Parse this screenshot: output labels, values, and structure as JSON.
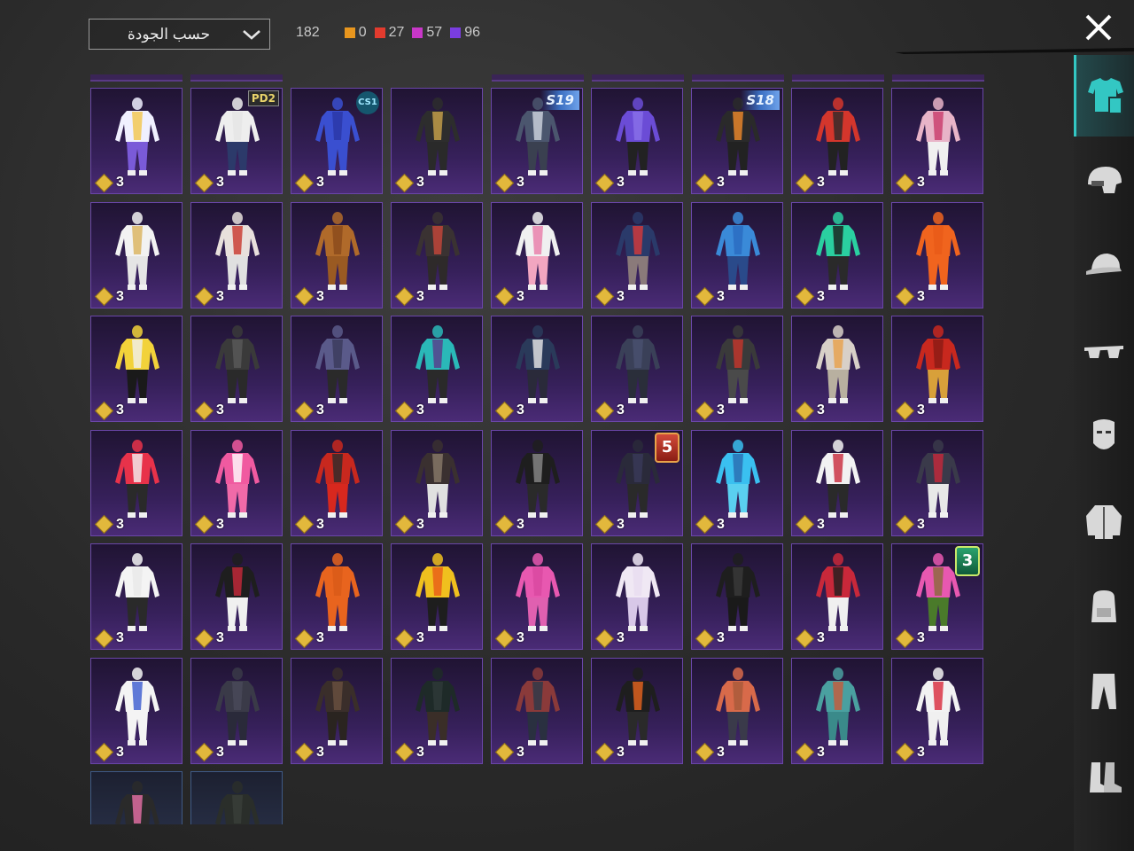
{
  "header": {
    "sort_label": "حسب الجودة",
    "total_count": "182",
    "quality_counts": [
      {
        "color": "#e8961e",
        "value": "0"
      },
      {
        "color": "#e33b2e",
        "value": "27"
      },
      {
        "color": "#c837c8",
        "value": "57"
      },
      {
        "color": "#7a3de0",
        "value": "96"
      }
    ]
  },
  "items": [
    {
      "qty": "3",
      "badge": "",
      "colors": [
        "#f0f0ff",
        "#f2c64a",
        "#7a5ad8"
      ]
    },
    {
      "qty": "3",
      "badge": "PD2",
      "badge_type": "pp",
      "colors": [
        "#eeeeee",
        "#e5e5e5",
        "#2c3a6a"
      ]
    },
    {
      "qty": "3",
      "badge": "CS1",
      "badge_type": "cs",
      "colors": [
        "#3a4fd0",
        "#2a36a5",
        "#3a4fd0"
      ]
    },
    {
      "qty": "3",
      "badge": "",
      "colors": [
        "#2d2d2d",
        "#c9a24a",
        "#2a2a2a"
      ]
    },
    {
      "qty": "3",
      "badge": "S19",
      "badge_type": "season",
      "colors": [
        "#4b566e",
        "#d0d6e0",
        "#3a4050"
      ]
    },
    {
      "qty": "3",
      "badge": "",
      "colors": [
        "#6b4cd6",
        "#8a70e8",
        "#222222"
      ]
    },
    {
      "qty": "3",
      "badge": "S18",
      "badge_type": "season",
      "colors": [
        "#2a2a2a",
        "#f08a2a",
        "#222222"
      ]
    },
    {
      "qty": "3",
      "badge": "",
      "colors": [
        "#d4362c",
        "#2b2b2b",
        "#222222"
      ]
    },
    {
      "qty": "3",
      "badge": "",
      "colors": [
        "#e8b4c8",
        "#c83a6a",
        "#f0f0f0"
      ]
    },
    {
      "qty": "3",
      "badge": "",
      "colors": [
        "#f2f2f2",
        "#d9b25a",
        "#e5e5e5"
      ]
    },
    {
      "qty": "3",
      "badge": "",
      "colors": [
        "#e8e0dc",
        "#c8362c",
        "#e0e0e0"
      ]
    },
    {
      "qty": "3",
      "badge": "",
      "colors": [
        "#b06a2a",
        "#8a4a1c",
        "#9a5a22"
      ]
    },
    {
      "qty": "3",
      "badge": "",
      "colors": [
        "#3a3232",
        "#c8463a",
        "#2e2a2a"
      ]
    },
    {
      "qty": "3",
      "badge": "",
      "colors": [
        "#f0f0f0",
        "#e87aa8",
        "#f2a6c0"
      ]
    },
    {
      "qty": "3",
      "badge": "",
      "colors": [
        "#2a3a6a",
        "#d83a3a",
        "#8a7a7a"
      ]
    },
    {
      "qty": "3",
      "badge": "",
      "colors": [
        "#3a8ad8",
        "#2a6ac0",
        "#2a4a8a"
      ]
    },
    {
      "qty": "3",
      "badge": "",
      "colors": [
        "#2ad0a0",
        "#1a1a1a",
        "#2a2a2a"
      ]
    },
    {
      "qty": "3",
      "badge": "",
      "colors": [
        "#f0641e",
        "#e85a18",
        "#f0641e"
      ]
    },
    {
      "qty": "3",
      "badge": "",
      "colors": [
        "#f2d23a",
        "#f0f0f0",
        "#1a1a1a"
      ]
    },
    {
      "qty": "3",
      "badge": "",
      "colors": [
        "#3a3a3a",
        "#5a5a5a",
        "#2a2a2a"
      ]
    },
    {
      "qty": "3",
      "badge": "",
      "colors": [
        "#5a5a8a",
        "#3a3a5a",
        "#2a2a2a"
      ]
    },
    {
      "qty": "3",
      "badge": "",
      "colors": [
        "#2ab8b8",
        "#5a3a8a",
        "#2a2a2a"
      ]
    },
    {
      "qty": "3",
      "badge": "",
      "colors": [
        "#2a3a5a",
        "#e8e8e8",
        "#2a2a3a"
      ]
    },
    {
      "qty": "3",
      "badge": "",
      "colors": [
        "#3a4058",
        "#4a5070",
        "#2a2e3a"
      ]
    },
    {
      "qty": "3",
      "badge": "",
      "colors": [
        "#3a3a3a",
        "#c8362c",
        "#4a4a4a"
      ]
    },
    {
      "qty": "3",
      "badge": "",
      "colors": [
        "#d8d0c8",
        "#e8a04a",
        "#b8b0a0"
      ]
    },
    {
      "qty": "3",
      "badge": "",
      "colors": [
        "#c8281e",
        "#8a1a14",
        "#d8a03a"
      ]
    },
    {
      "qty": "3",
      "badge": "",
      "colors": [
        "#e8324a",
        "#f2f2f2",
        "#2a2a2a"
      ]
    },
    {
      "qty": "3",
      "badge": "",
      "colors": [
        "#f05aa0",
        "#ffffff",
        "#f06aa8"
      ]
    },
    {
      "qty": "3",
      "badge": "",
      "colors": [
        "#c8281e",
        "#2a2a2a",
        "#d8281e"
      ]
    },
    {
      "qty": "3",
      "badge": "",
      "colors": [
        "#3a3030",
        "#8a7a6a",
        "#e0e0e0"
      ]
    },
    {
      "qty": "3",
      "badge": "",
      "colors": [
        "#1e1e1e",
        "#8a8a8a",
        "#2a2a2a"
      ]
    },
    {
      "qty": "3",
      "badge": "5",
      "badge_type": "rank-red",
      "colors": [
        "#2a2a3a",
        "#3a3a5a",
        "#2a2a2a"
      ]
    },
    {
      "qty": "3",
      "badge": "",
      "colors": [
        "#3ac0f0",
        "#2a6ab0",
        "#5ad0f0"
      ]
    },
    {
      "qty": "3",
      "badge": "",
      "colors": [
        "#f2f2f2",
        "#c8283a",
        "#2a2a2a"
      ]
    },
    {
      "qty": "3",
      "badge": "",
      "colors": [
        "#3a3a4a",
        "#c8283a",
        "#e8e8e8"
      ]
    },
    {
      "qty": "3",
      "badge": "",
      "colors": [
        "#f4f4f4",
        "#e8e8e8",
        "#2a2a2a"
      ]
    },
    {
      "qty": "3",
      "badge": "",
      "colors": [
        "#1e1e1e",
        "#c8283a",
        "#f0f0f0"
      ]
    },
    {
      "qty": "3",
      "badge": "",
      "colors": [
        "#e8641e",
        "#d85a18",
        "#e8641e"
      ]
    },
    {
      "qty": "3",
      "badge": "",
      "colors": [
        "#f0c01e",
        "#e85a18",
        "#1e1e1e"
      ]
    },
    {
      "qty": "3",
      "badge": "",
      "colors": [
        "#e858b0",
        "#d848a0",
        "#e060b0"
      ]
    },
    {
      "qty": "3",
      "badge": "",
      "colors": [
        "#f0e8f4",
        "#e8dcf0",
        "#d8c8e8"
      ]
    },
    {
      "qty": "3",
      "badge": "",
      "colors": [
        "#1e1e1e",
        "#3a3a3a",
        "#1a1a1a"
      ]
    },
    {
      "qty": "3",
      "badge": "",
      "colors": [
        "#c8283a",
        "#1e1e1e",
        "#f0f0f0"
      ]
    },
    {
      "qty": "3",
      "badge": "3",
      "badge_type": "rank-green",
      "colors": [
        "#e858b0",
        "#8a6a3a",
        "#4a7a2a"
      ]
    },
    {
      "qty": "3",
      "badge": "",
      "colors": [
        "#f4f4f4",
        "#3a5ad0",
        "#f4f4f4"
      ]
    },
    {
      "qty": "3",
      "badge": "",
      "colors": [
        "#3a3a48",
        "#4a4a5a",
        "#2a2a3a"
      ]
    },
    {
      "qty": "3",
      "badge": "",
      "colors": [
        "#3a2e2a",
        "#6a5040",
        "#2a2420"
      ]
    },
    {
      "qty": "3",
      "badge": "",
      "colors": [
        "#1e2a28",
        "#2e3a38",
        "#3a2e28"
      ]
    },
    {
      "qty": "3",
      "badge": "",
      "colors": [
        "#8a3a3a",
        "#2a3a4a",
        "#2a3040"
      ]
    },
    {
      "qty": "3",
      "badge": "",
      "colors": [
        "#1e1e1e",
        "#e8641e",
        "#2a2a2a"
      ]
    },
    {
      "qty": "3",
      "badge": "",
      "colors": [
        "#d86a4a",
        "#a85a3a",
        "#3a3a4a"
      ]
    },
    {
      "qty": "3",
      "badge": "",
      "colors": [
        "#4aa0a0",
        "#c85a3a",
        "#3a8a8a"
      ]
    },
    {
      "qty": "3",
      "badge": "",
      "colors": [
        "#f2f2f2",
        "#d8283a",
        "#f0f0f0"
      ]
    },
    {
      "qty": "",
      "badge": "",
      "colors": [
        "#2a2a2a",
        "#e870a8",
        "#1e1e1e"
      ],
      "partial": true,
      "frame": "blue"
    },
    {
      "qty": "",
      "badge": "",
      "colors": [
        "#2a2e2a",
        "#3a3e3a",
        "#1e1e1e"
      ],
      "partial": true,
      "frame": "blue"
    }
  ],
  "sidebar": [
    {
      "icon": "outfit-icon",
      "active": true
    },
    {
      "icon": "helmet-icon",
      "active": false
    },
    {
      "icon": "cap-icon",
      "active": false
    },
    {
      "icon": "glasses-icon",
      "active": false
    },
    {
      "icon": "mask-icon",
      "active": false
    },
    {
      "icon": "jacket-icon",
      "active": false
    },
    {
      "icon": "backpack-icon",
      "active": false
    },
    {
      "icon": "pants-icon",
      "active": false
    },
    {
      "icon": "shoes-icon",
      "active": false
    }
  ]
}
